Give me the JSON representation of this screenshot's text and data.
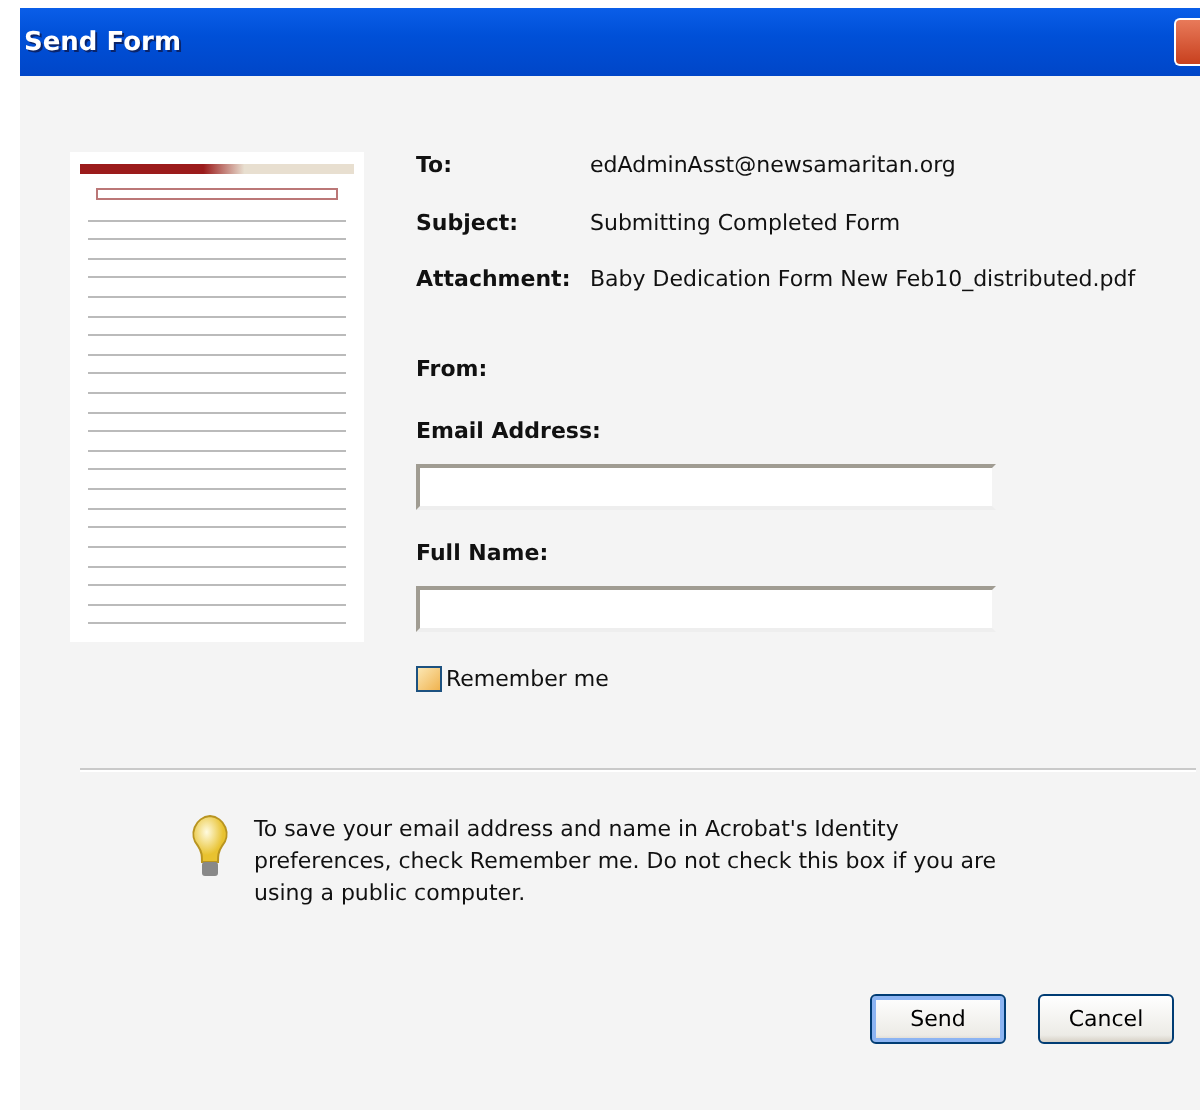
{
  "window": {
    "title": "Send Form"
  },
  "details": [
    {
      "label": "To:",
      "value": "edAdminAsst@newsamaritan.org"
    },
    {
      "label": "Subject:",
      "value": "Submitting Completed Form"
    },
    {
      "label": "Attachment:",
      "value": "Baby Dedication Form New Feb10_distributed.pdf"
    }
  ],
  "from": {
    "heading": "From:",
    "fields": [
      {
        "label": "Email Address:"
      },
      {
        "label": "Full Name:"
      }
    ]
  },
  "remember": {
    "label": "Remember me",
    "checked": false
  },
  "hint": "To save your email address and name in Acrobat's Identity preferences, check Remember me. Do not check this box if you are using a public computer.",
  "buttons": [
    {
      "label": "Send",
      "default": true
    },
    {
      "label": "Cancel",
      "default": false
    }
  ]
}
